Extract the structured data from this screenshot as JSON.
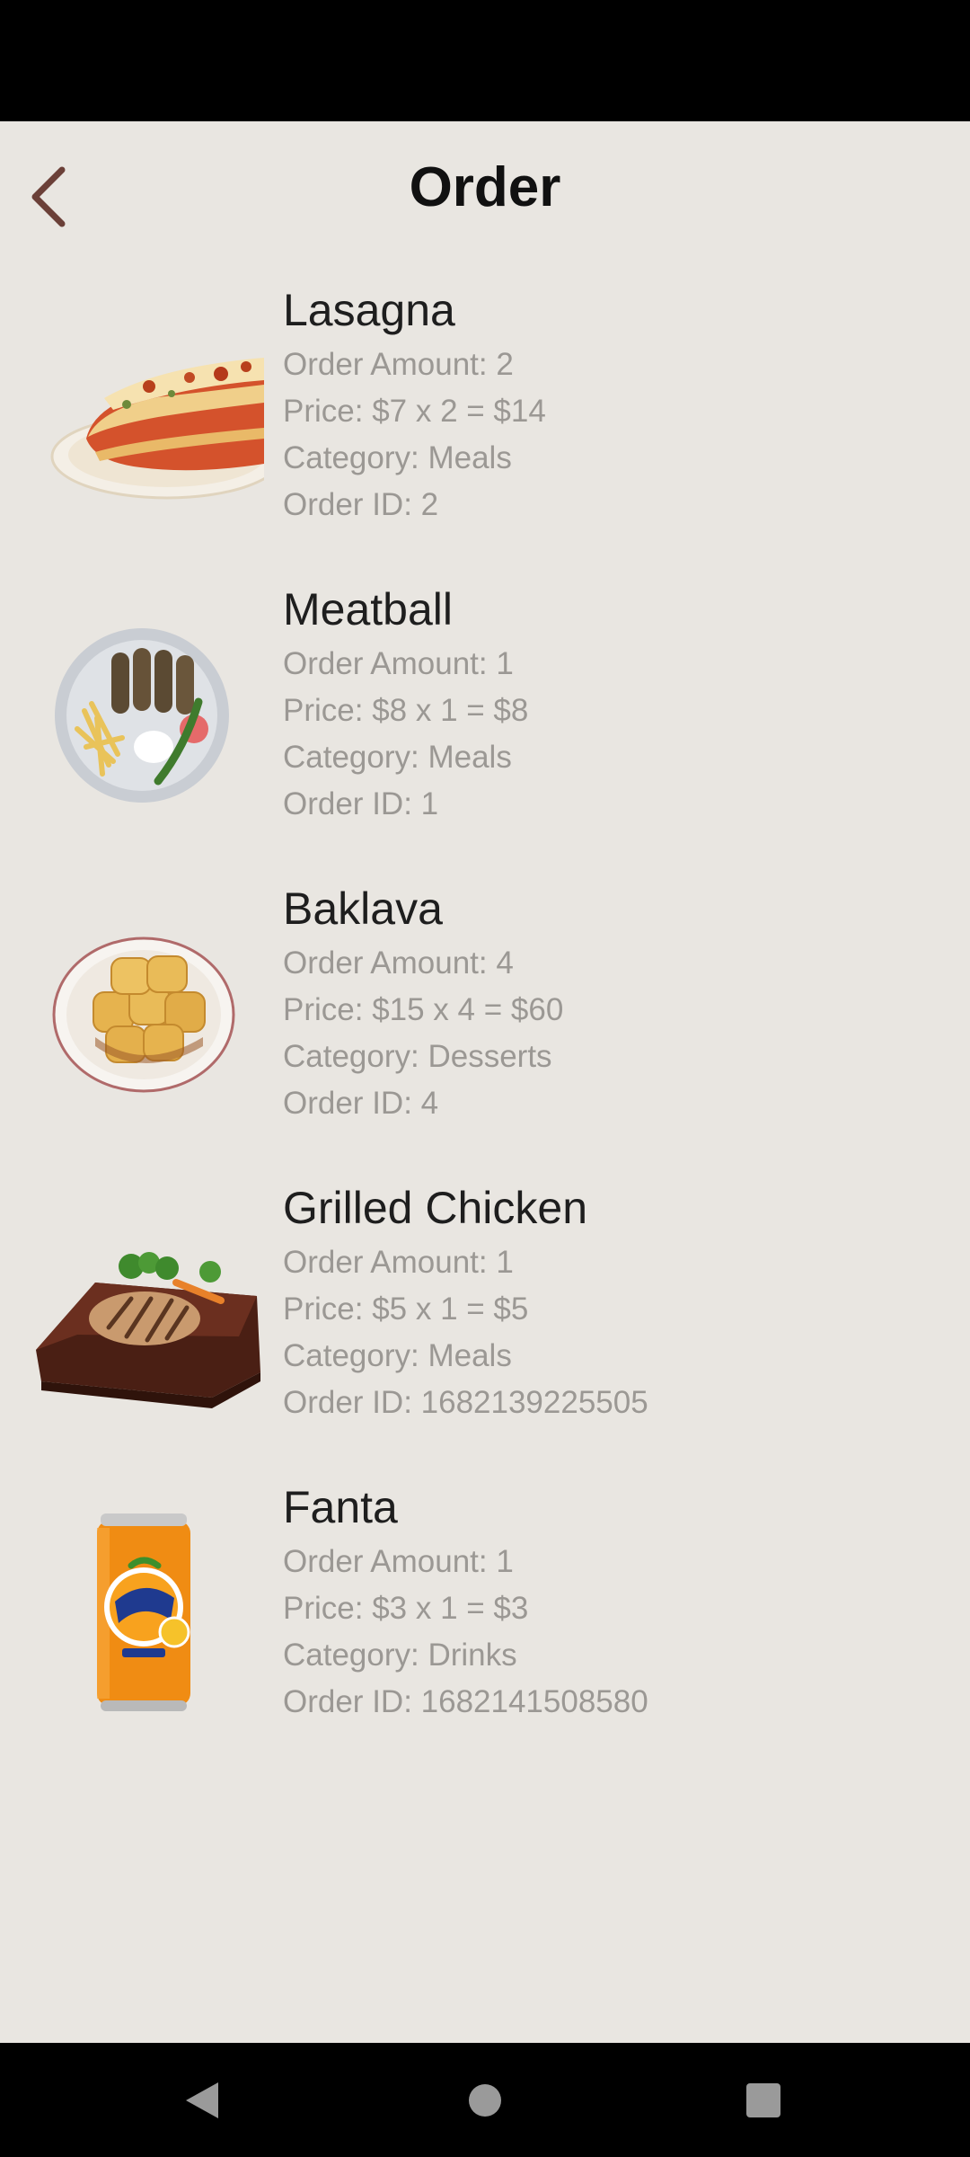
{
  "header": {
    "title": "Order"
  },
  "orders": [
    {
      "name": "Lasagna",
      "amount": "Order Amount: 2",
      "price": "Price: $7 x 2 = $14",
      "category": "Category: Meals",
      "order_id": "Order ID: 2",
      "image_icon": "lasagna-image"
    },
    {
      "name": "Meatball",
      "amount": "Order Amount: 1",
      "price": "Price: $8 x 1 = $8",
      "category": "Category: Meals",
      "order_id": "Order ID: 1",
      "image_icon": "meatball-plate-image"
    },
    {
      "name": "Baklava",
      "amount": "Order Amount: 4",
      "price": "Price: $15 x 4 = $60",
      "category": "Category: Desserts",
      "order_id": "Order ID: 4",
      "image_icon": "baklava-plate-image"
    },
    {
      "name": "Grilled Chicken",
      "amount": "Order Amount: 1",
      "price": "Price: $5 x 1 = $5",
      "category": "Category: Meals",
      "order_id": "Order ID: 1682139225505",
      "image_icon": "grilled-chicken-board-image"
    },
    {
      "name": "Fanta",
      "amount": "Order Amount: 1",
      "price": "Price: $3 x 1 = $3",
      "category": "Category: Drinks",
      "order_id": "Order ID: 1682141508580",
      "image_icon": "fanta-can-image"
    }
  ],
  "colors": {
    "background": "#e9e6e1",
    "title_text": "#111111",
    "name_text": "#1e1e1e",
    "detail_text": "#9b9894",
    "back_arrow": "#6b4038"
  }
}
